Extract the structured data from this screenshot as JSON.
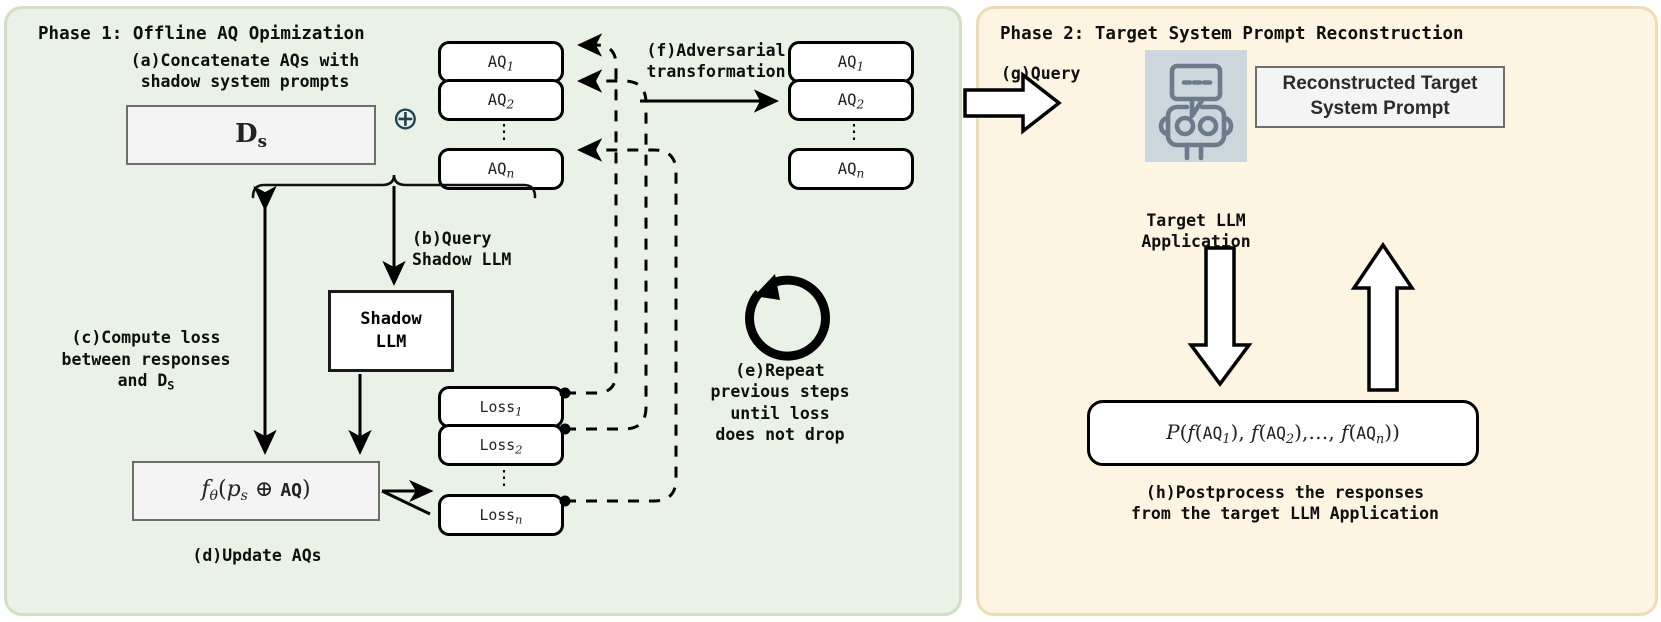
{
  "phase1": {
    "title": "Phase 1: Offline AQ Opimization",
    "step_a": "(a)Concatenate AQs with\nshadow system prompts",
    "step_b": "(b)Query\nShadow LLM",
    "step_c": "(c)Compute loss\nbetween responses\nand D",
    "step_c_sub": "S",
    "step_d": "(d)Update AQs",
    "step_e": "(e)Repeat\nprevious steps\nuntil loss\ndoes not drop",
    "step_f": "(f)Adversarial\ntransformation",
    "dataset_box": "D",
    "dataset_box_sub": "s",
    "plus_symbol": "⊕",
    "shadow_llm_box": "Shadow\nLLM",
    "loss_fn_box": "fθ(p_s ⊕ AQ)",
    "aq_left": [
      {
        "base": "AQ",
        "sub": "1"
      },
      {
        "base": "AQ",
        "sub": "2"
      },
      {
        "base": "AQ",
        "sub": "n"
      }
    ],
    "aq_right": [
      {
        "base": "AQ",
        "sub": "1"
      },
      {
        "base": "AQ",
        "sub": "2"
      },
      {
        "base": "AQ",
        "sub": "n"
      }
    ],
    "loss_boxes": [
      {
        "base": "Loss",
        "sub": "1"
      },
      {
        "base": "Loss",
        "sub": "2"
      },
      {
        "base": "Loss",
        "sub": "n"
      }
    ],
    "ellipsis": "⋮",
    "repeat_icon": "circular-arrow"
  },
  "phase2": {
    "title": "Phase 2: Target System Prompt Reconstruction",
    "step_g": "(g)Query",
    "step_h": "(h)Postprocess the responses\nfrom the target LLM Application",
    "target_llm_label": "Target LLM\nApplication",
    "robot_icon": "robot-icon",
    "reconstructed_box": "Reconstructed Target\nSystem Prompt",
    "postprocess_formula": "P(f(AQ1), f(AQ2), ..., f(AQn))"
  },
  "colors": {
    "phase1_bg": "#eaf2e7",
    "phase1_border": "#cfe0c3",
    "phase2_bg": "#fdf4e1",
    "phase2_border": "#eedcb4",
    "box_fill_grey": "#f4f4f4",
    "box_border_grey": "#6e6e6e",
    "stroke_black": "#000000",
    "robot_tile": "#ccd6dd",
    "robot_stroke": "#6b7b8c",
    "plus_color": "#1f4356"
  }
}
